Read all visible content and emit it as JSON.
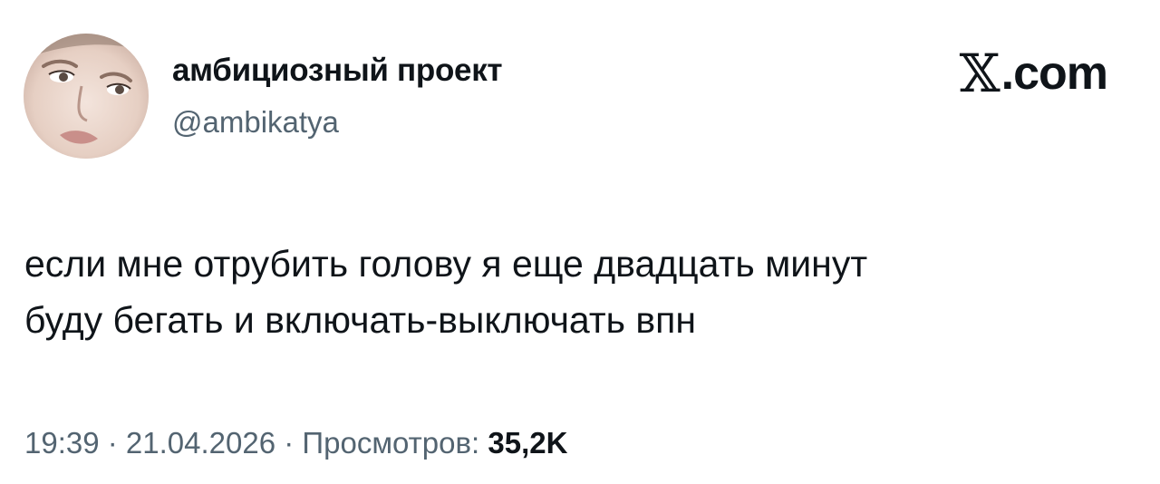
{
  "author": {
    "display_name": "амбициозный проект",
    "handle": "@ambikatya",
    "avatar": "user-portrait-avatar"
  },
  "brand": {
    "icon": "x-logo-icon",
    "x_glyph": "𝕏",
    "suffix": ".com"
  },
  "tweet": {
    "lines": [
      "если мне отрубить голову я еще двадцать минут",
      "буду бегать и включать-выключать впн"
    ]
  },
  "meta": {
    "time": "19:39",
    "separator": " · ",
    "date": "21.04.2026",
    "views_label": "Просмотров: ",
    "views_count": "35,2K"
  },
  "colors": {
    "text": "#0f1419",
    "secondary": "#536471",
    "background": "#ffffff"
  }
}
